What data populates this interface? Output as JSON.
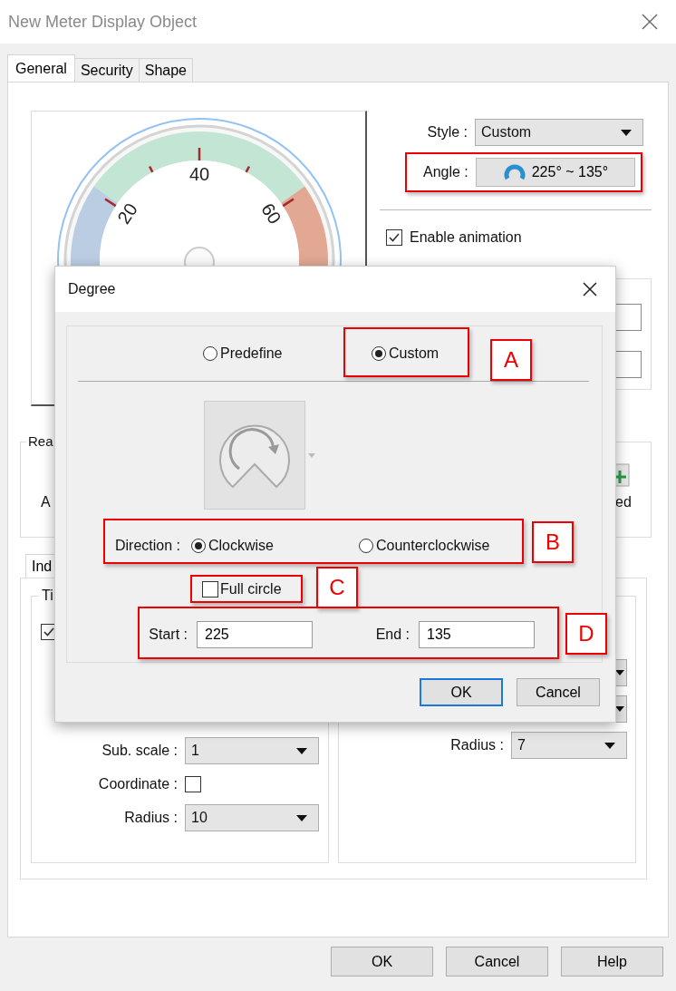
{
  "window": {
    "title": "New Meter Display Object"
  },
  "tabs": [
    {
      "label": "General",
      "selected": true
    },
    {
      "label": "Security",
      "selected": false
    },
    {
      "label": "Shape",
      "selected": false
    }
  ],
  "gauge": {
    "labels": [
      "20",
      "40",
      "60"
    ]
  },
  "style": {
    "label": "Style :",
    "value": "Custom"
  },
  "angle": {
    "label": "Angle :",
    "value": "225° ~ 135°",
    "highlighted": true
  },
  "enable_animation": {
    "label": "Enable animation",
    "checked": true
  },
  "reading_group": {
    "title": "Rea",
    "text_left": "A",
    "text_right": "ed"
  },
  "sub_tabs": [
    {
      "label": "Ind",
      "selected": true
    }
  ],
  "tick_group": {
    "title": "Ti",
    "checked": true,
    "fields": [
      {
        "kind": "select",
        "label": "Sub. scale :",
        "value": "1"
      },
      {
        "kind": "checkbox",
        "label": "Coordinate :",
        "checked": false
      },
      {
        "kind": "select",
        "label": "Radius :",
        "value": "10"
      }
    ]
  },
  "right_group": {
    "fields": [
      {
        "kind": "select",
        "label": "Radius :",
        "value": "7"
      }
    ]
  },
  "buttons": [
    "OK",
    "Cancel",
    "Help"
  ],
  "degree_dialog": {
    "title": "Degree",
    "mode": [
      {
        "label": "Predefine",
        "selected": false
      },
      {
        "label": "Custom",
        "selected": true
      }
    ],
    "direction": {
      "label": "Direction :",
      "options": [
        {
          "label": "Clockwise",
          "selected": true
        },
        {
          "label": "Counterclockwise",
          "selected": false
        }
      ]
    },
    "full_circle": {
      "label": "Full circle",
      "checked": false
    },
    "start": {
      "label": "Start :",
      "value": "225"
    },
    "end": {
      "label": "End :",
      "value": "135"
    },
    "buttons": [
      {
        "label": "OK",
        "default": true
      },
      {
        "label": "Cancel",
        "default": false
      }
    ],
    "callouts": [
      "A",
      "B",
      "C",
      "D"
    ]
  }
}
